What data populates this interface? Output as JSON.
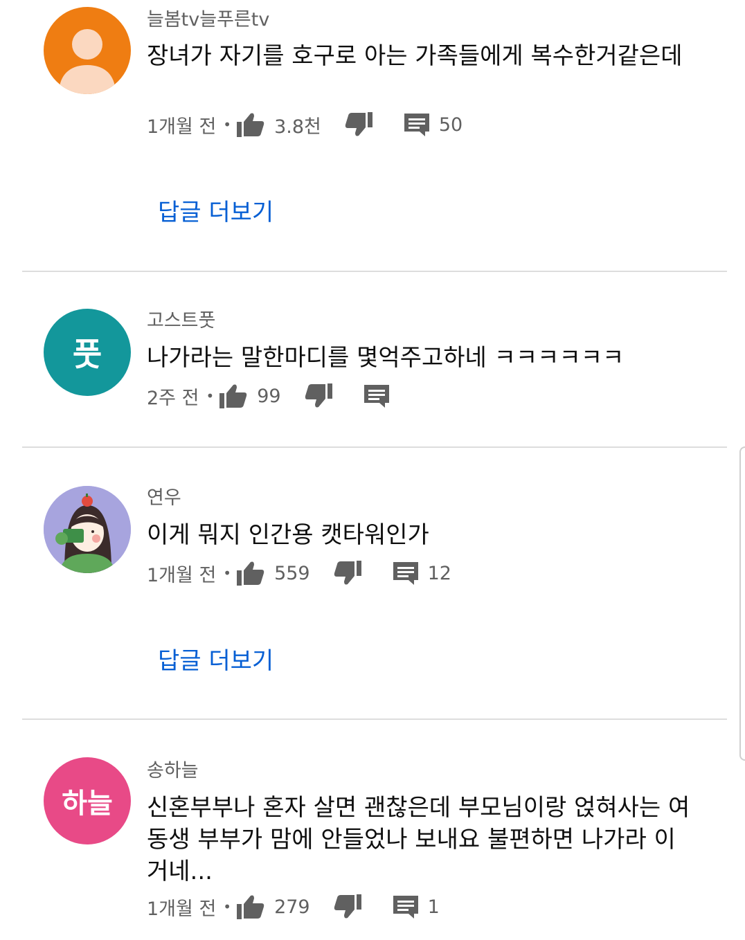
{
  "comments": [
    {
      "author": "늘봄tv늘푸른tv",
      "text": "장녀가 자기를 호구로 아는 가족들에게 복수한거같은데",
      "time": "1개월 전",
      "likes": "3.8천",
      "replies": "50",
      "more_replies": "답글 더보기",
      "avatar": {
        "type": "default-person",
        "color": "#ef7d12"
      }
    },
    {
      "author": "고스트풋",
      "text": "나가라는 말한마디를 몇억주고하네 ㅋㅋㅋㅋㅋㅋ",
      "time": "2주 전",
      "likes": "99",
      "replies": "",
      "avatar": {
        "type": "letter",
        "letter": "풋",
        "color": "#13979b"
      }
    },
    {
      "author": "연우",
      "text": "이게 뭐지 인간용 캣타워인가",
      "time": "1개월 전",
      "likes": "559",
      "replies": "12",
      "more_replies": "답글 더보기",
      "avatar": {
        "type": "illustration",
        "color": "#a7a4de"
      }
    },
    {
      "author": "송하늘",
      "text": "신혼부부나 혼자 살면 괜찮은데 부모님이랑 얹혀사는 여동생 부부가 맘에 안들었나 보내요 불편하면 나가라 이거네...",
      "time": "1개월 전",
      "likes": "279",
      "replies": "1",
      "avatar": {
        "type": "letter",
        "letter": "하늘",
        "color": "#e84a87"
      }
    }
  ],
  "icons": {
    "like": "thumbs-up-icon",
    "dislike": "thumbs-down-icon",
    "reply": "comment-icon"
  },
  "colors": {
    "link": "#065fd4",
    "secondary_text": "#606060",
    "icon": "#606060"
  }
}
